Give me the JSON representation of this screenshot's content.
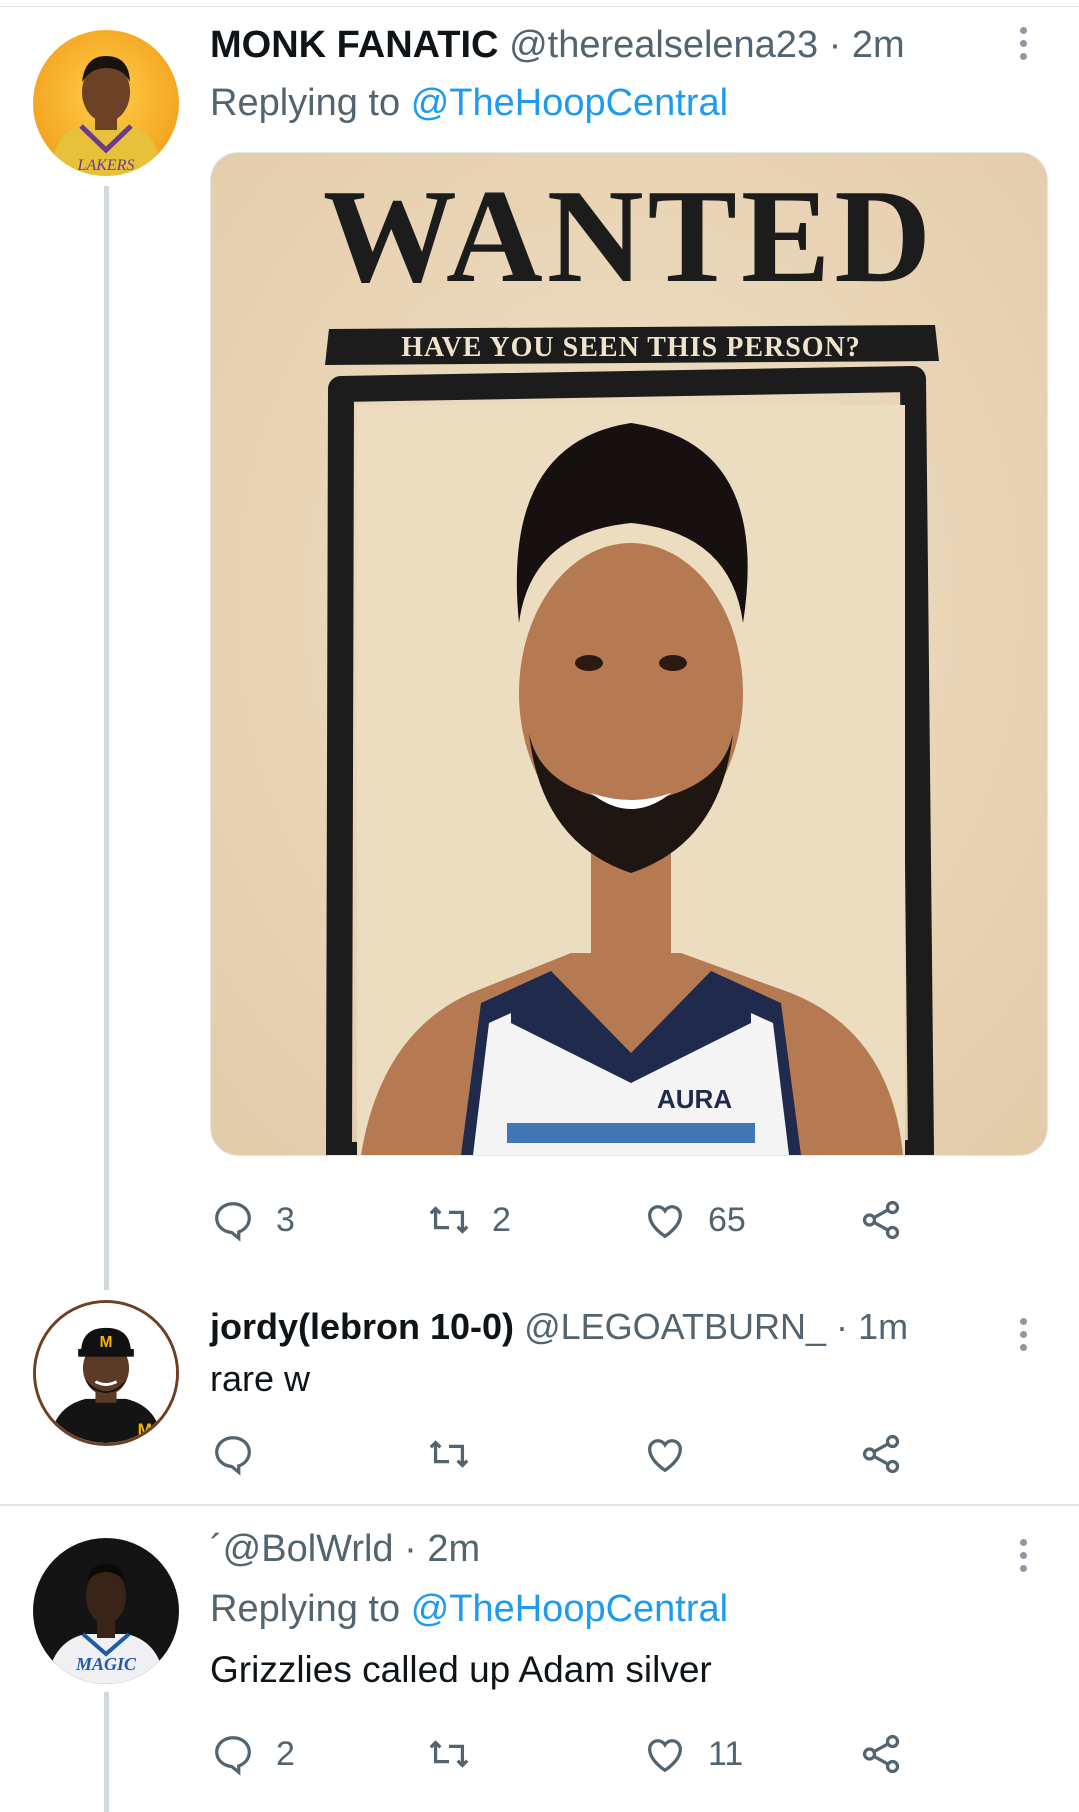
{
  "tweets": [
    {
      "name": "MONK FANATIC",
      "handle": "@therealselena23",
      "time": "2m",
      "reply_prefix": "Replying to",
      "reply_to": "@TheHoopCentral",
      "media": {
        "wanted": "WANTED",
        "subtitle": "HAVE YOU SEEN THIS PERSON?",
        "jersey": "AURA"
      },
      "counts": {
        "reply": "3",
        "retweet": "2",
        "like": "65"
      }
    },
    {
      "name": "jordy(lebron 10-0)",
      "handle": "@LEGOATBURN_",
      "time": "1m",
      "text": "rare w",
      "counts": {
        "reply": "",
        "retweet": "",
        "like": ""
      }
    },
    {
      "name": "",
      "handle": "´@BolWrld",
      "time": "2m",
      "reply_prefix": "Replying to",
      "reply_to": "@TheHoopCentral",
      "text": "Grizzlies called up Adam silver",
      "counts": {
        "reply": "2",
        "retweet": "",
        "like": "11"
      }
    }
  ],
  "icons": [
    "reply-icon",
    "retweet-icon",
    "like-icon",
    "share-icon",
    "more-icon"
  ],
  "colors": {
    "link": "#1d9bf0",
    "secondary": "#536471",
    "line": "#cfd9de"
  }
}
